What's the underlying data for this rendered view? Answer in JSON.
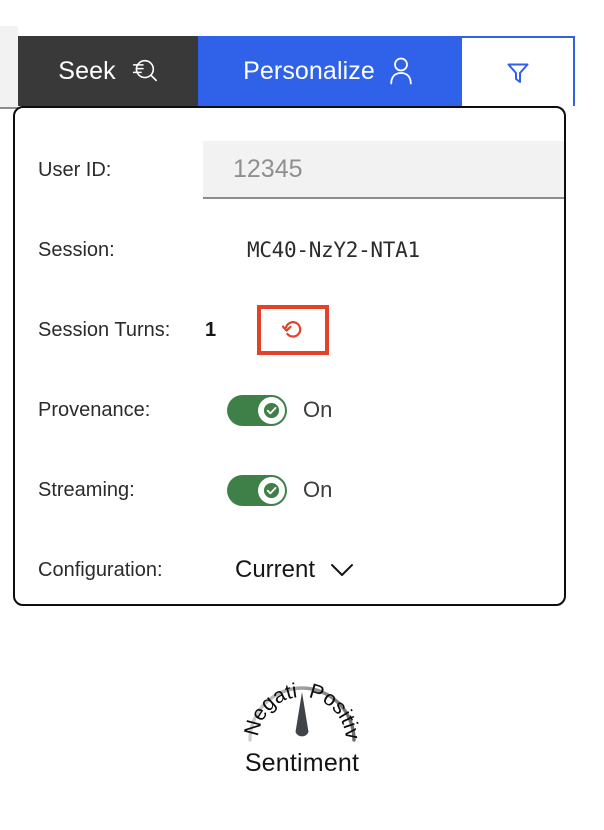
{
  "tabs": [
    {
      "id": "seek",
      "label": "Seek",
      "icon": "search-document-icon",
      "state": "inactive",
      "bg": "#393939"
    },
    {
      "id": "personalize",
      "label": "Personalize",
      "icon": "user-icon",
      "state": "active",
      "bg": "#2f62e8"
    },
    {
      "id": "filter",
      "label": "",
      "icon": "filter-funnel-icon",
      "state": "inactive",
      "bg": "#ffffff"
    }
  ],
  "panel": {
    "user_id": {
      "label": "User ID:",
      "value": "",
      "placeholder": "12345"
    },
    "session": {
      "label": "Session:",
      "value": "MC40-NzY2-NTA1"
    },
    "session_turns": {
      "label": "Session Turns:",
      "value": "1",
      "reset_icon": "reset-rotate-icon",
      "highlight_color": "#e5412a"
    },
    "provenance": {
      "label": "Provenance:",
      "state": "On",
      "enabled": true
    },
    "streaming": {
      "label": "Streaming:",
      "state": "On",
      "enabled": true
    },
    "configuration": {
      "label": "Configuration:",
      "value": "Current",
      "chevron": "chevron-down-icon"
    }
  },
  "gauge": {
    "caption": "Sentiment",
    "left_label": "Negative",
    "right_label": "Positive",
    "needle_value": 50,
    "needle_color": "#3f4448",
    "arc_color_start": "#c9c9c9",
    "arc_color_end": "#6e6e6e"
  },
  "colors": {
    "accent_blue": "#2f62e8",
    "dark_tab": "#393939",
    "toggle_green": "#3f8048",
    "highlight_red": "#e5412a"
  }
}
